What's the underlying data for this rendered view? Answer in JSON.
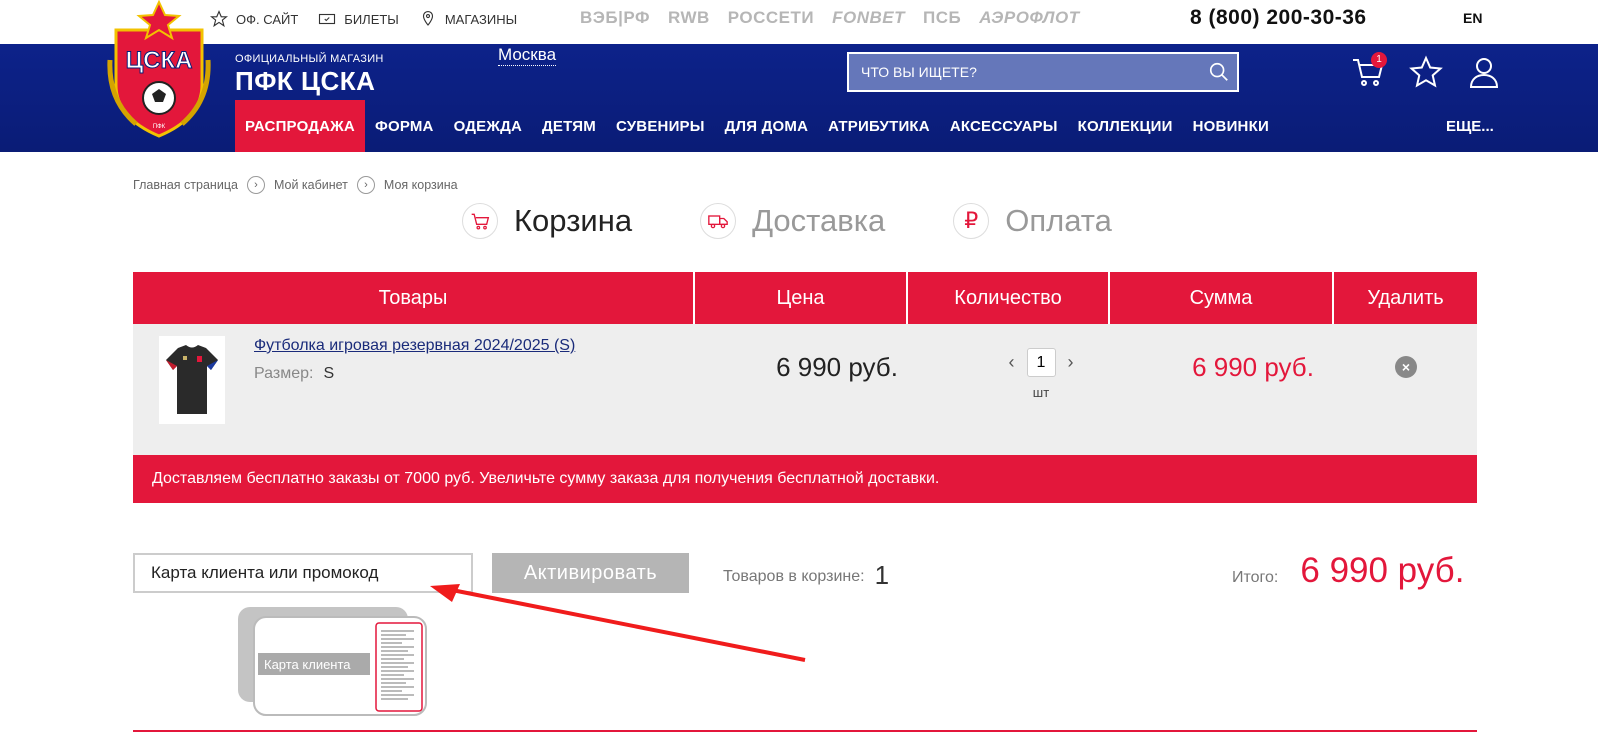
{
  "topbar": {
    "links": [
      {
        "label": "ОФ. САЙТ",
        "icon": "star-icon"
      },
      {
        "label": "БИЛЕТЫ",
        "icon": "ticket-icon"
      },
      {
        "label": "МАГАЗИНЫ",
        "icon": "location-pin-icon"
      }
    ],
    "sponsors": [
      "ВЭБ|РФ",
      "RWB",
      "РОССЕТИ",
      "FONBET",
      "ПСБ",
      "АЭРОФЛОТ"
    ],
    "phone": "8 (800) 200-30-36",
    "lang": "EN"
  },
  "header": {
    "logo_text": "ЦСКА",
    "subtitle": "ОФИЦИАЛЬНЫЙ МАГАЗИН",
    "brand": "ПФК ЦСКА",
    "city": "Москва",
    "search_placeholder": "ЧТО ВЫ ИЩЕТЕ?",
    "cart_count": "1",
    "nav": [
      "РАСПРОДАЖА",
      "ФОРМА",
      "ОДЕЖДА",
      "ДЕТЯМ",
      "СУВЕНИРЫ",
      "ДЛЯ ДОМА",
      "АТРИБУТИКА",
      "АКСЕССУАРЫ",
      "КОЛЛЕКЦИИ",
      "НОВИНКИ"
    ],
    "nav_more": "ЕЩЕ..."
  },
  "breadcrumbs": [
    "Главная страница",
    "Мой кабинет",
    "Моя корзина"
  ],
  "steps": [
    {
      "label": "Корзина",
      "icon": "cart-icon",
      "active": true
    },
    {
      "label": "Доставка",
      "icon": "truck-icon",
      "active": false
    },
    {
      "label": "Оплата",
      "icon": "ruble-icon",
      "active": false
    }
  ],
  "table": {
    "headers": [
      "Товары",
      "Цена",
      "Количество",
      "Сумма",
      "Удалить"
    ],
    "row": {
      "name": "Футболка игровая резервная 2024/2025 (S)",
      "size_label": "Размер:",
      "size_value": "S",
      "price": "6 990 руб.",
      "qty": "1",
      "unit": "шт",
      "sum": "6 990 руб."
    }
  },
  "notice": "Доставляем бесплатно заказы от 7000 руб. Увеличьте сумму заказа для получения бесплатной доставки.",
  "promo": {
    "placeholder": "Карта клиента или промокод",
    "button": "Активировать",
    "count_label": "Товаров в корзине:",
    "count_value": "1",
    "total_label": "Итого:",
    "total_value": "6 990 руб.",
    "card_label": "Карта клиента"
  },
  "colors": {
    "brand_red": "#e3173b",
    "brand_blue": "#0d228a"
  }
}
